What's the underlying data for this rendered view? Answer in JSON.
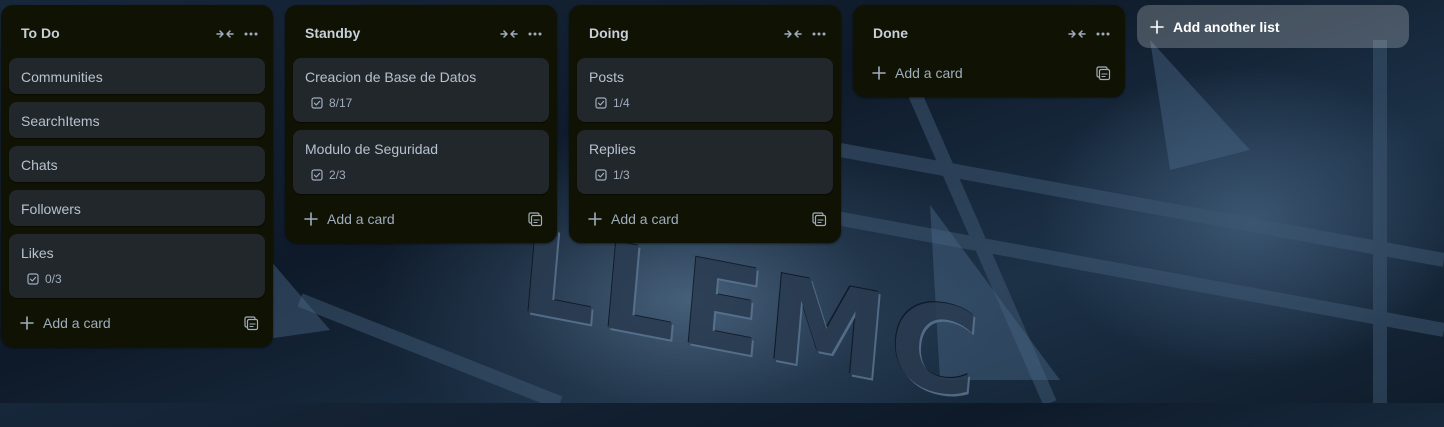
{
  "lists": [
    {
      "title": "To Do",
      "cards": [
        {
          "title": "Communities"
        },
        {
          "title": "SearchItems"
        },
        {
          "title": "Chats"
        },
        {
          "title": "Followers"
        },
        {
          "title": "Likes",
          "checklist": "0/3"
        }
      ],
      "add_card_label": "Add a card"
    },
    {
      "title": "Standby",
      "cards": [
        {
          "title": "Creacion de Base de Datos",
          "checklist": "8/17"
        },
        {
          "title": "Modulo de Seguridad",
          "checklist": "2/3"
        }
      ],
      "add_card_label": "Add a card"
    },
    {
      "title": "Doing",
      "cards": [
        {
          "title": "Posts",
          "checklist": "1/4"
        },
        {
          "title": "Replies",
          "checklist": "1/3"
        }
      ],
      "add_card_label": "Add a card"
    },
    {
      "title": "Done",
      "cards": [],
      "add_card_label": "Add a card"
    }
  ],
  "add_list_label": "Add another list",
  "icons": {
    "collapse": "collapse-arrows-icon",
    "more": "more-horizontal-icon",
    "checklist": "checkbox-icon",
    "plus": "plus-icon",
    "template": "card-template-icon"
  },
  "colors": {
    "list_bg": "#101204",
    "card_bg": "#22272b",
    "text_primary": "#b6c2cf",
    "text_secondary": "#9fadbc",
    "add_list_bg": "rgba(255,255,255,0.22)"
  }
}
